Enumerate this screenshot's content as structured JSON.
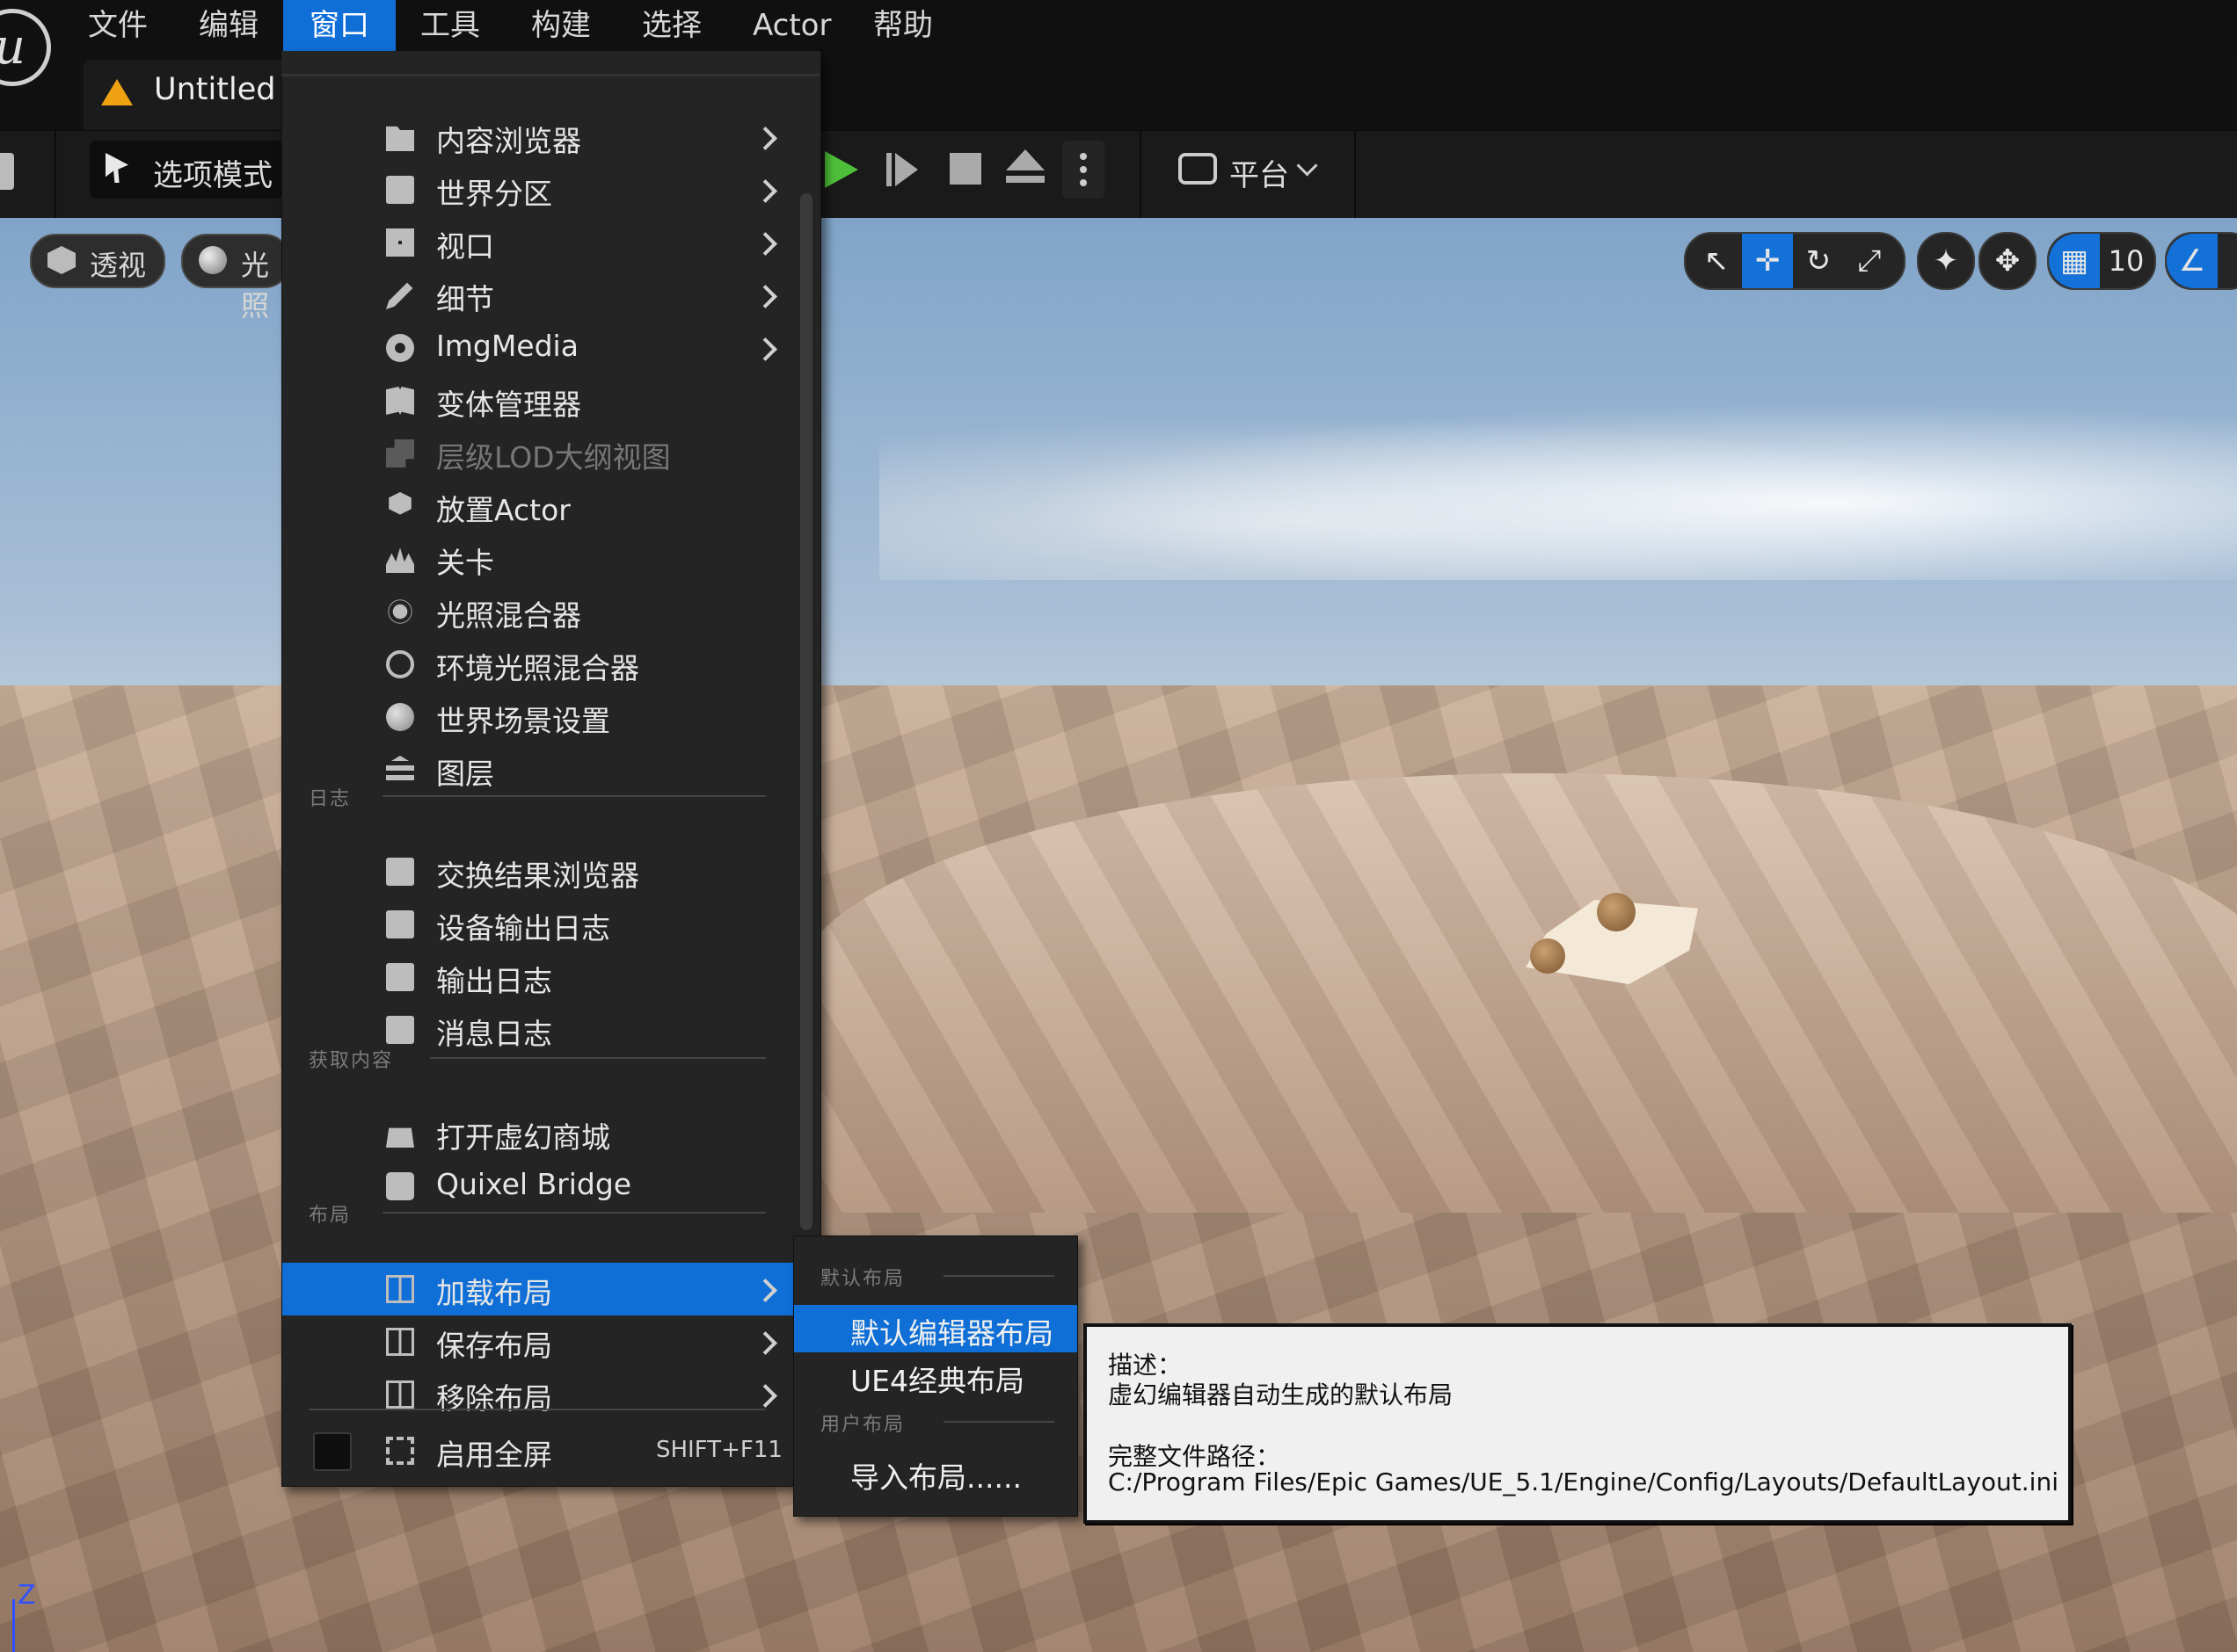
{
  "menubar": {
    "items": [
      {
        "label": "文件"
      },
      {
        "label": "编辑"
      },
      {
        "label": "窗口"
      },
      {
        "label": "工具"
      },
      {
        "label": "构建"
      },
      {
        "label": "选择"
      },
      {
        "label": "Actor"
      },
      {
        "label": "帮助"
      }
    ],
    "active_index": 2,
    "active_color": "#0f6fd6"
  },
  "document_tab": {
    "label": "Untitled"
  },
  "toolbar": {
    "select_mode_label": "选项模式",
    "platform_label": "平台",
    "play_color": "#4fbf3a"
  },
  "viewport": {
    "perspective_label": "透视",
    "lit_label": "光照",
    "grid_snap_value": "10",
    "axis_label": "Z"
  },
  "window_menu": {
    "items": [
      {
        "label": "内容浏览器",
        "icon": "content-browser-icon",
        "submenu": true
      },
      {
        "label": "世界分区",
        "icon": "world-partition-icon",
        "submenu": true
      },
      {
        "label": "视口",
        "icon": "viewport-icon",
        "submenu": true
      },
      {
        "label": "细节",
        "icon": "details-icon",
        "submenu": true
      },
      {
        "label": "ImgMedia",
        "icon": "imgmedia-icon",
        "submenu": true
      },
      {
        "label": "变体管理器",
        "icon": "variant-manager-icon"
      },
      {
        "label": "层级LOD大纲视图",
        "icon": "hlod-outliner-icon",
        "disabled": true
      },
      {
        "label": "放置Actor",
        "icon": "place-actor-icon"
      },
      {
        "label": "关卡",
        "icon": "levels-icon"
      },
      {
        "label": "光照混合器",
        "icon": "light-mixer-icon"
      },
      {
        "label": "环境光照混合器",
        "icon": "env-light-mixer-icon"
      },
      {
        "label": "世界场景设置",
        "icon": "world-settings-icon"
      },
      {
        "label": "图层",
        "icon": "layers-icon"
      }
    ],
    "log_section": "日志",
    "log_items": [
      {
        "label": "交换结果浏览器",
        "icon": "interchange-results-icon"
      },
      {
        "label": "设备输出日志",
        "icon": "device-output-log-icon"
      },
      {
        "label": "输出日志",
        "icon": "output-log-icon"
      },
      {
        "label": "消息日志",
        "icon": "message-log-icon"
      }
    ],
    "content_section": "获取内容",
    "content_items": [
      {
        "label": "打开虚幻商城",
        "icon": "marketplace-icon"
      },
      {
        "label": "Quixel Bridge",
        "icon": "quixel-bridge-icon"
      }
    ],
    "layout_section": "布局",
    "layout_items": [
      {
        "label": "加载布局",
        "icon": "load-layout-icon",
        "submenu": true,
        "highlighted": true
      },
      {
        "label": "保存布局",
        "icon": "save-layout-icon",
        "submenu": true
      },
      {
        "label": "移除布局",
        "icon": "remove-layout-icon",
        "submenu": true
      }
    ],
    "fullscreen": {
      "label": "启用全屏",
      "shortcut": "SHIFT+F11",
      "checked": false
    }
  },
  "load_layout_submenu": {
    "default_section": "默认布局",
    "default_items": [
      {
        "label": "默认编辑器布局",
        "highlighted": true
      },
      {
        "label": "UE4经典布局"
      }
    ],
    "user_section": "用户布局",
    "user_items": [
      {
        "label": "导入布局......"
      }
    ]
  },
  "tooltip": {
    "desc_heading": "描述：",
    "desc_text": "虚幻编辑器自动生成的默认布局",
    "path_heading": "完整文件路径：",
    "path_text": "C:/Program Files/Epic Games/UE_5.1/Engine/Config/Layouts/DefaultLayout.ini"
  }
}
